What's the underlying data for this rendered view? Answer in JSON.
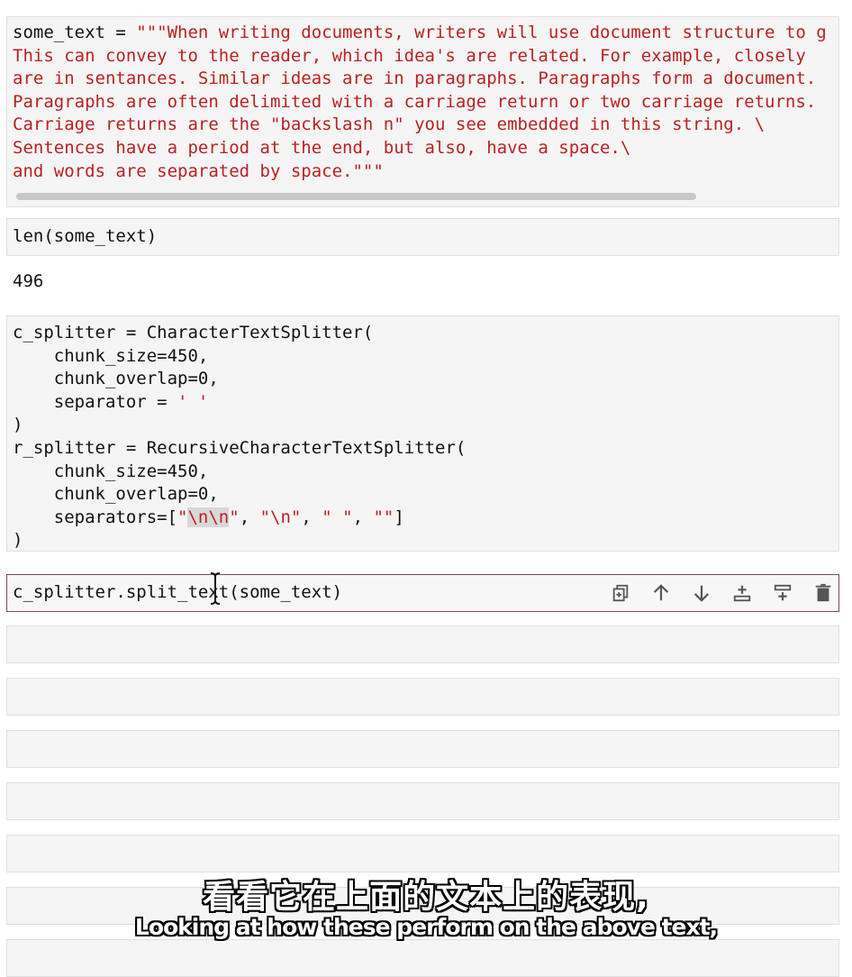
{
  "cells": {
    "some_text": {
      "line1_var": "some_text",
      "line1_eq": " = ",
      "line1_str": "\"\"\"When writing documents, writers will use document structure to g",
      "line2": "This can convey to the reader, which idea's are related. For example, closely",
      "line3": "are in sentances. Similar ideas are in paragraphs. Paragraphs form a document.",
      "line4": "Paragraphs are often delimited with a carriage return or two carriage returns.",
      "line5": "Carriage returns are the \"backslash n\" you see embedded in this string. \\",
      "line6": "Sentences have a period at the end, but also, have a space.\\",
      "line7": "and words are separated by space.\"\"\""
    },
    "len": {
      "code": "len(some_text)",
      "output": "496"
    },
    "splitters": {
      "l1a": "c_splitter = ",
      "l1b": "CharacterTextSplitter(",
      "l2": "    chunk_size=450,",
      "l3": "    chunk_overlap=0,",
      "l4a": "    separator = ",
      "l4b": "' '",
      "l5": ")",
      "l6a": "r_splitter = ",
      "l6b": "RecursiveCharacterTextSplitter(",
      "l7": "    chunk_size=450,",
      "l8": "    chunk_overlap=0,",
      "l9a": "    separators=[",
      "l9q1": "\"",
      "l9sel": "\\n\\n",
      "l9q2": "\"",
      "l9rest_a": ", ",
      "l9s2": "\"\\n\"",
      "l9rest_b": ", ",
      "l9s3": "\" \"",
      "l9rest_c": ", ",
      "l9s4": "\"\"",
      "l9end": "]",
      "l10": ")"
    },
    "active": {
      "code": "c_splitter.split_text(some_text)"
    }
  },
  "toolbar": {
    "icons": [
      "duplicate-icon",
      "arrow-up-icon",
      "arrow-down-icon",
      "insert-above-icon",
      "insert-below-icon",
      "delete-icon"
    ]
  },
  "subtitles": {
    "chinese": "看看它在上面的文本上的表现,",
    "english": "Looking at how these perform on the above text,"
  }
}
